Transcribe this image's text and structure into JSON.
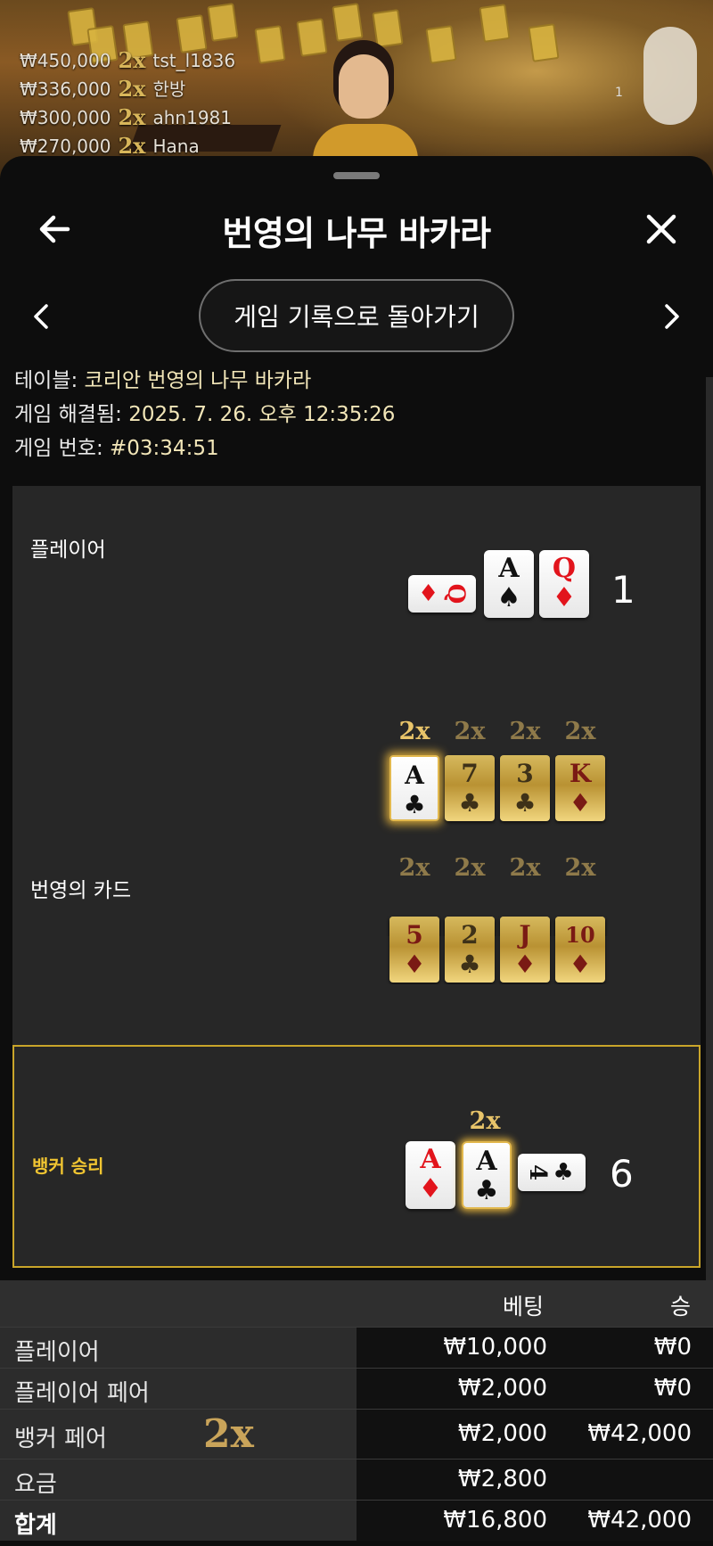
{
  "live": {
    "winners": [
      {
        "amount": "₩450,000",
        "mult": "2x",
        "user": "tst_l1836"
      },
      {
        "amount": "₩336,000",
        "mult": "2x",
        "user": "한방"
      },
      {
        "amount": "₩300,000",
        "mult": "2x",
        "user": "ahn1981"
      },
      {
        "amount": "₩270,000",
        "mult": "2x",
        "user": "Hana"
      }
    ],
    "count": "1"
  },
  "header": {
    "title": "번영의 나무 바카라",
    "back_icon": "arrow-left-icon",
    "close_icon": "close-icon"
  },
  "nav": {
    "back_to_history": "게임 기록으로 돌아가기",
    "prev_icon": "chevron-left-icon",
    "next_icon": "chevron-right-icon"
  },
  "info": {
    "table_label": "테이블:",
    "table_value": "코리안 번영의 나무 바카라",
    "resolved_label": "게임 해결됨:",
    "resolved_value": "2025. 7. 26. 오후 12:35:26",
    "number_label": "게임 번호:",
    "number_value": "#03:34:51"
  },
  "board": {
    "player_label": "플레이어",
    "player_score": "1",
    "player_cards": [
      {
        "rank": "Q",
        "suit": "♦",
        "color": "red",
        "orientation": "side"
      },
      {
        "rank": "A",
        "suit": "♠",
        "color": "black"
      },
      {
        "rank": "Q",
        "suit": "♦",
        "color": "red"
      }
    ],
    "prosperity_label": "번영의 카드",
    "prosperity_row1": [
      {
        "mult": "2x",
        "rank": "A",
        "suit": "♣",
        "color": "black",
        "active": true
      },
      {
        "mult": "2x",
        "rank": "7",
        "suit": "♣",
        "color": "black",
        "active": false
      },
      {
        "mult": "2x",
        "rank": "3",
        "suit": "♣",
        "color": "black",
        "active": false
      },
      {
        "mult": "2x",
        "rank": "K",
        "suit": "♦",
        "color": "red",
        "active": false
      }
    ],
    "prosperity_row2": [
      {
        "mult": "2x",
        "rank": "5",
        "suit": "♦",
        "color": "red",
        "active": false
      },
      {
        "mult": "2x",
        "rank": "2",
        "suit": "♣",
        "color": "black",
        "active": false
      },
      {
        "mult": "2x",
        "rank": "J",
        "suit": "♦",
        "color": "red",
        "active": false
      },
      {
        "mult": "2x",
        "rank": "10",
        "suit": "♦",
        "color": "red",
        "active": false
      }
    ],
    "banker_label": "뱅커 승리",
    "banker_score": "6",
    "banker_mult": "2x",
    "banker_cards": [
      {
        "rank": "A",
        "suit": "♦",
        "color": "red"
      },
      {
        "rank": "A",
        "suit": "♣",
        "color": "black",
        "glow": true
      },
      {
        "rank": "4",
        "suit": "♣",
        "color": "black",
        "orientation": "side"
      }
    ]
  },
  "table": {
    "col_bet": "베팅",
    "col_win": "승",
    "rows": [
      {
        "name": "플레이어",
        "bet": "₩10,000",
        "win": "₩0"
      },
      {
        "name": "플레이어 페어",
        "bet": "₩2,000",
        "win": "₩0"
      },
      {
        "name": "뱅커 페어",
        "mult": "2x",
        "bet": "₩2,000",
        "win": "₩42,000"
      },
      {
        "name": "요금",
        "bet": "₩2,800",
        "win": ""
      },
      {
        "name": "합계",
        "bet": "₩16,800",
        "win": "₩42,000"
      }
    ]
  },
  "colors": {
    "accent_gold": "#c9a52a",
    "banker_label": "#f1c531",
    "card_red": "#e2141c"
  }
}
